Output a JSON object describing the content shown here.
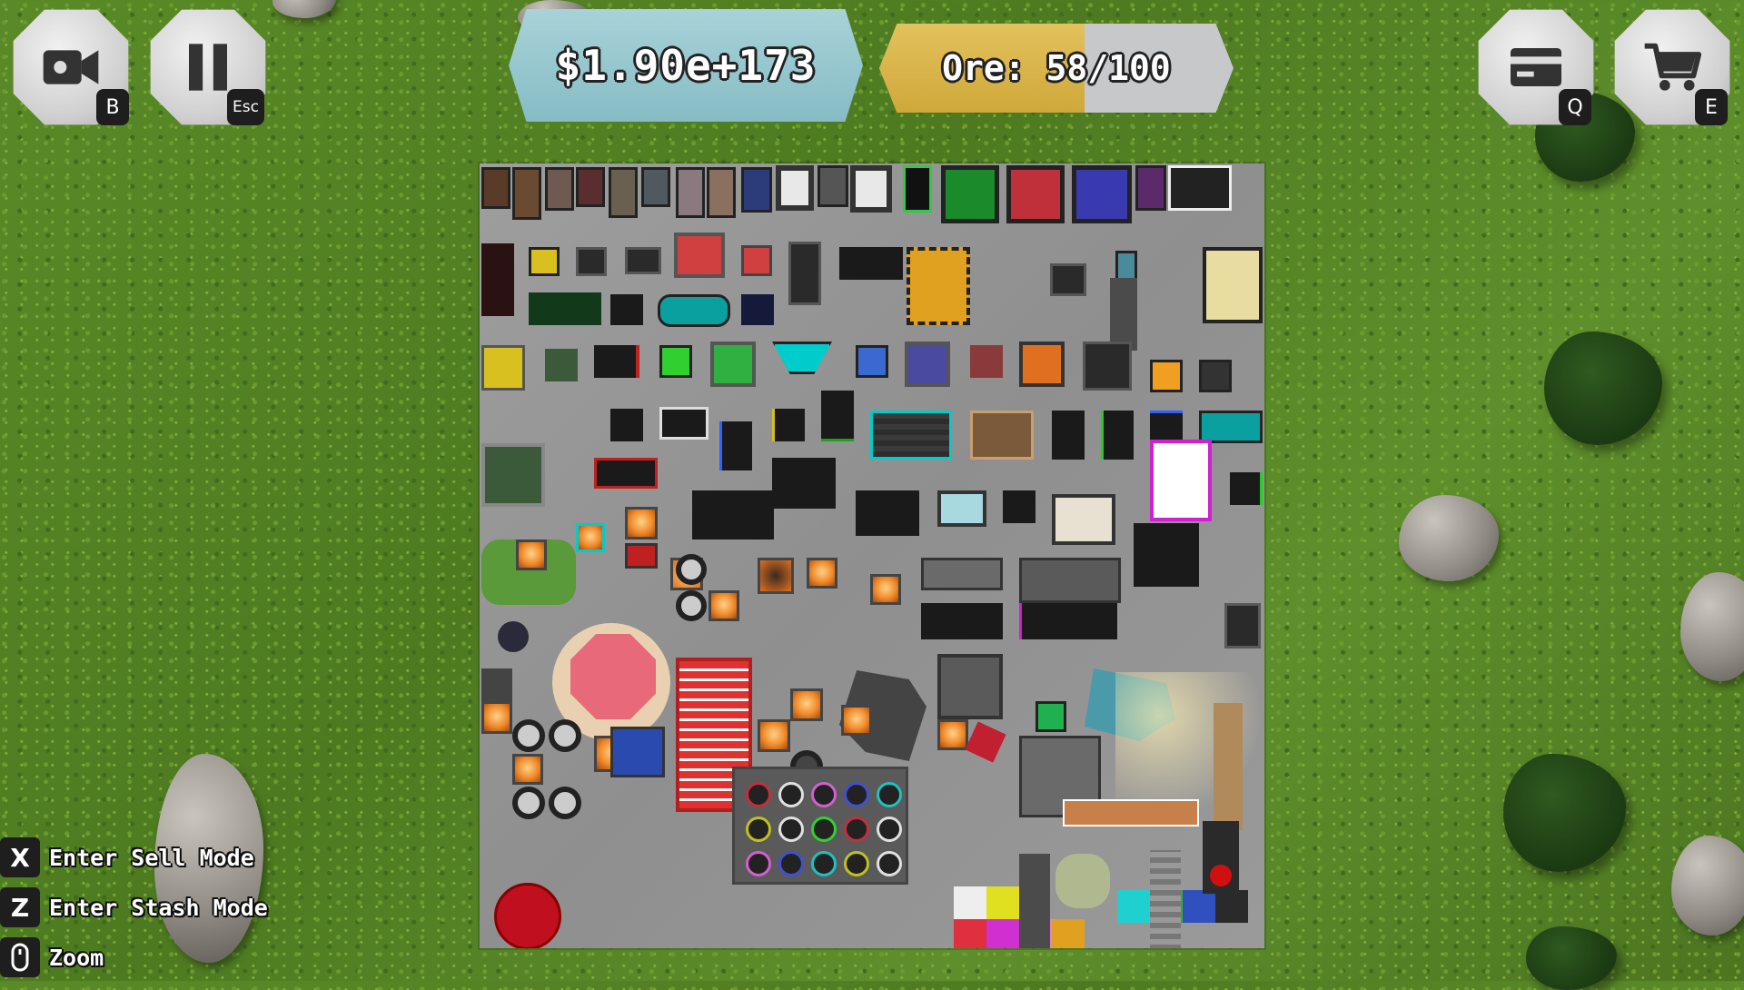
{
  "hud": {
    "money": "$1.90e+173",
    "ore": {
      "text": "Ore: 58/100",
      "current": 58,
      "max": 100
    },
    "buttons": {
      "camera": {
        "icon": "video-camera-icon",
        "key": "B"
      },
      "pause": {
        "icon": "pause-icon",
        "key": "Esc"
      },
      "inventory": {
        "icon": "card-icon",
        "key": "Q"
      },
      "shop": {
        "icon": "shopping-cart-icon",
        "key": "E"
      }
    }
  },
  "controls": [
    {
      "key": "X",
      "label": "Enter Sell Mode"
    },
    {
      "key": "Z",
      "label": "Enter Stash Mode"
    },
    {
      "key": "mouse-scroll-icon",
      "label": "Zoom"
    }
  ],
  "colors": {
    "money_box": "#86bcc4",
    "ore_fill": "#cfa83a",
    "ore_empty": "#c6c8c9",
    "plate": "#9a9a9a",
    "grass": "#5a8a27"
  }
}
